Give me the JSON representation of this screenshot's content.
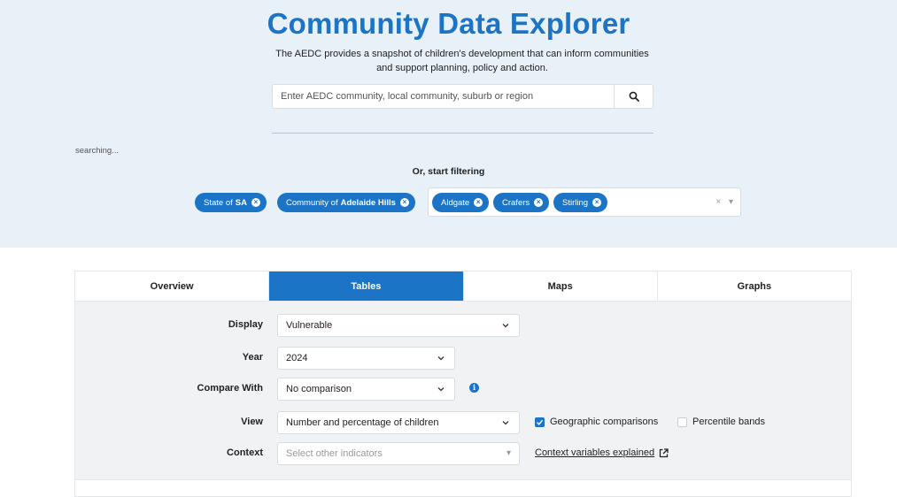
{
  "header": {
    "title": "Community Data Explorer",
    "subtitle": "The AEDC provides a snapshot of children's development that can inform communities and support planning, policy and action."
  },
  "search": {
    "placeholder": "Enter AEDC community, local community, suburb or region",
    "status": "searching..."
  },
  "filters": {
    "heading": "Or, start filtering",
    "state": {
      "prefix": "State of",
      "value": "SA"
    },
    "community": {
      "prefix": "Community of",
      "value": "Adelaide Hills"
    },
    "locals": [
      "Aldgate",
      "Crafers",
      "Stirling"
    ],
    "clear_symbol": "×",
    "colors": {
      "accent": "#1b74c5",
      "hero_bg": "#e8f0f8"
    }
  },
  "tabs": [
    "Overview",
    "Tables",
    "Maps",
    "Graphs"
  ],
  "active_tab": "Tables",
  "form": {
    "display": {
      "label": "Display",
      "value": "Vulnerable"
    },
    "year": {
      "label": "Year",
      "value": "2024"
    },
    "compare": {
      "label": "Compare With",
      "value": "No comparison",
      "info_icon": "i"
    },
    "view": {
      "label": "View",
      "value": "Number and percentage of children"
    },
    "context": {
      "label": "Context",
      "placeholder": "Select other indicators"
    },
    "geo_comparisons": {
      "label": "Geographic comparisons",
      "checked": true
    },
    "percentile_bands": {
      "label": "Percentile bands",
      "checked": false
    },
    "context_link": "Context variables explained"
  }
}
